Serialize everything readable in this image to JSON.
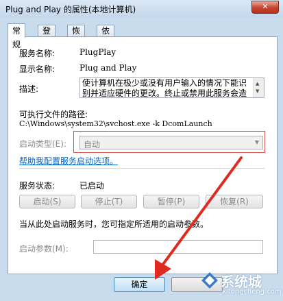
{
  "window": {
    "title": "Plug and Play 的属性(本地计算机)",
    "close_glyph": "✕"
  },
  "tabs": [
    {
      "label": "常规",
      "active": true
    },
    {
      "label": "登录"
    },
    {
      "label": "恢复"
    },
    {
      "label": "依存关系"
    }
  ],
  "general": {
    "service_name_label": "服务名称:",
    "service_name_value": "PlugPlay",
    "display_name_label": "显示名称:",
    "display_name_value": "Plug and Play",
    "description_label": "描述:",
    "description_value": "使计算机在极少或没有用户输入的情况下能识别并适应硬件的更改。终止或禁用此服务会造",
    "exe_path_label": "可执行文件的路径:",
    "exe_path_value": "C:\\Windows\\system32\\svchost.exe -k DcomLaunch",
    "startup_type_label": "启动类型(E):",
    "startup_type_value": "自动",
    "help_link": "帮助我配置服务启动选项。",
    "service_status_label": "服务状态:",
    "service_status_value": "已启动",
    "buttons": {
      "start": "启动(S)",
      "stop": "停止(T)",
      "pause": "暂停(P)",
      "resume": "恢复(R)"
    },
    "start_params_hint": "当从此处启动服务时，您可指定所适用的启动参数。",
    "start_params_label": "启动参数(M):",
    "start_params_value": ""
  },
  "footer": {
    "ok_label": "确定"
  },
  "watermark": {
    "brand": "系统城",
    "url": "xitongcheng.com"
  },
  "colors": {
    "highlight_box": "#d9534f",
    "arrow": "#e02a20",
    "link": "#0066cc"
  }
}
